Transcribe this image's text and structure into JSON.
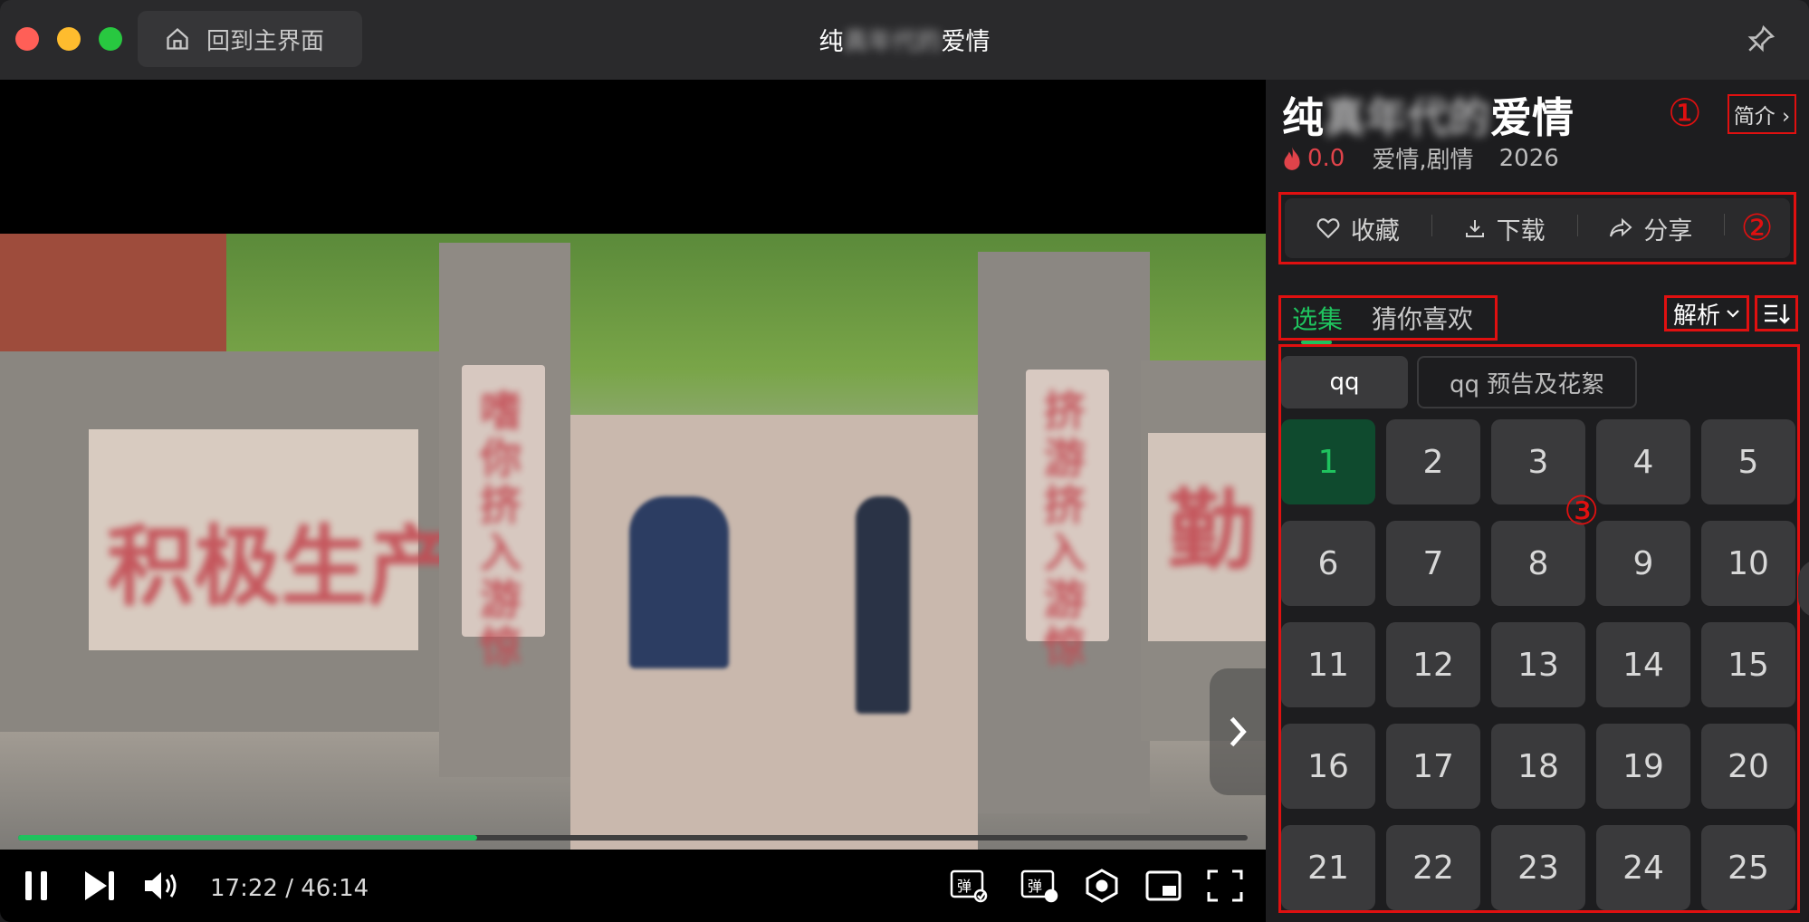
{
  "window": {
    "title_prefix": "纯",
    "title_blurred": "真年代的",
    "title_suffix": "爱情",
    "home_label": "回到主界面"
  },
  "player": {
    "current_time": "17:22",
    "separator": "/",
    "duration": "46:14",
    "progress_fraction": 0.373,
    "scene_text": {
      "left_panel": "积极生产",
      "right_panel": "勤",
      "left_plaque": "嗜你挤入游惊",
      "right_plaque": "挤游挤入游惊"
    }
  },
  "sidebar": {
    "title_prefix": "纯",
    "title_blurred": "真年代的",
    "title_suffix": "爱情",
    "intro_label": "简介 ›",
    "annotation_1": "①",
    "annotation_2": "②",
    "annotation_3": "③",
    "rating": "0.0",
    "genres": "爱情,剧情",
    "year": "2026",
    "actions": {
      "favorite": "收藏",
      "download": "下载",
      "share": "分享"
    },
    "tabs": [
      "选集",
      "猜你喜欢"
    ],
    "parse_label": "解析",
    "sources": [
      "qq",
      "qq 预告及花絮"
    ],
    "episodes": [
      "1",
      "2",
      "3",
      "4",
      "5",
      "6",
      "7",
      "8",
      "9",
      "10",
      "11",
      "12",
      "13",
      "14",
      "15",
      "16",
      "17",
      "18",
      "19",
      "20",
      "21",
      "22",
      "23",
      "24",
      "25"
    ],
    "current_episode": "1"
  },
  "colors": {
    "accent_green": "#1fc25e",
    "annotation_red": "#e01010",
    "rating_red": "#e0434a"
  }
}
